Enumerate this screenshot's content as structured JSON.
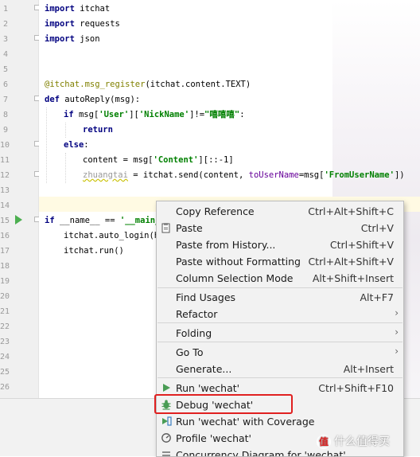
{
  "gutter": {
    "line_numbers": [
      "1",
      "2",
      "3",
      "4",
      "5",
      "6",
      "7",
      "8",
      "9",
      "10",
      "11",
      "12",
      "13",
      "14",
      "15",
      "16",
      "17",
      "18",
      "19",
      "20",
      "21",
      "22",
      "23",
      "24",
      "25",
      "26"
    ]
  },
  "code": {
    "line1_kw": "import",
    "line1_rest": " itchat",
    "line2_kw": "import",
    "line2_rest": " requests",
    "line3_kw": "import",
    "line3_rest": " json",
    "line6_deco": "@itchat.msg_register",
    "line6_rest": "(itchat.content.TEXT)",
    "line7_kw": "def",
    "line7_rest": " autoReply(msg):",
    "line8_kw": "if",
    "line8_a": " msg[",
    "line8_s1": "'User'",
    "line8_b": "][",
    "line8_s2": "'NickName'",
    "line8_c": "]!=",
    "line8_s3": "\"嘻嘻嘻\"",
    "line8_d": ":",
    "line9_kw": "return",
    "line10_kw": "else",
    "line10_rest": ":",
    "line11_a": "content = msg[",
    "line11_s": "'Content'",
    "line11_b": "][::-1]",
    "line12_var": "zhuangtai",
    "line12_a": " = itchat.send(content, ",
    "line12_p": "toUserName",
    "line12_b": "=msg[",
    "line12_s": "'FromUserName'",
    "line12_c": "])",
    "line15_kw": "if",
    "line15_a": " __name__ == ",
    "line15_s": "'__main_",
    "line16": "itchat.auto_login(ho",
    "line17": "itchat.run()"
  },
  "menu": {
    "items": [
      {
        "label": "Copy Reference",
        "shortcut": "Ctrl+Alt+Shift+C"
      },
      {
        "label": "Paste",
        "shortcut": "Ctrl+V"
      },
      {
        "label": "Paste from History...",
        "shortcut": "Ctrl+Shift+V"
      },
      {
        "label": "Paste without Formatting",
        "shortcut": "Ctrl+Alt+Shift+V"
      },
      {
        "label": "Column Selection Mode",
        "shortcut": "Alt+Shift+Insert"
      },
      {
        "label": "Find Usages",
        "shortcut": "Alt+F7"
      },
      {
        "label": "Refactor",
        "shortcut": ""
      },
      {
        "label": "Folding",
        "shortcut": ""
      },
      {
        "label": "Go To",
        "shortcut": ""
      },
      {
        "label": "Generate...",
        "shortcut": "Alt+Insert"
      },
      {
        "label": "Run 'wechat'",
        "shortcut": "Ctrl+Shift+F10"
      },
      {
        "label": "Debug 'wechat'",
        "shortcut": ""
      },
      {
        "label": "Run 'wechat' with Coverage",
        "shortcut": ""
      },
      {
        "label": "Profile 'wechat'",
        "shortcut": ""
      },
      {
        "label": "Concurrency Diagram for 'wechat'",
        "shortcut": ""
      }
    ],
    "icons": {
      "run": "run-icon",
      "debug": "debug-icon",
      "coverage": "coverage-icon",
      "profile": "profile-icon",
      "concurrency": "concurrency-icon"
    },
    "highlight_color": "#e02020"
  },
  "watermark": {
    "badge": "值",
    "text": "什么值得买"
  }
}
